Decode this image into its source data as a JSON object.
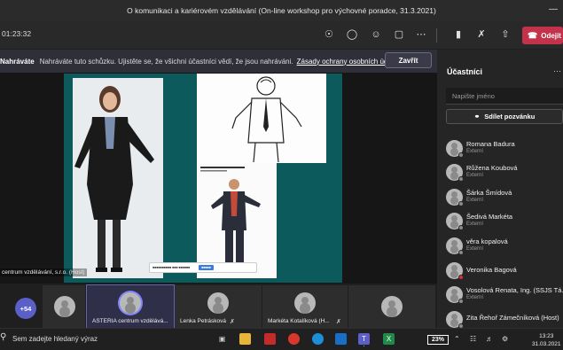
{
  "window": {
    "title": "O komunikaci a kariérovém vzdělávání (On-line workshop pro výchovné poradce, 31.3.2021)"
  },
  "toolbar": {
    "timer": "01:23:32",
    "leave_label": "Odejít"
  },
  "banner": {
    "title": "Nahráváte",
    "message": "Nahráváte tuto schůzku. Ujistěte se, že všichni účastníci vědí, že jsou nahráváni.",
    "link": "Zásady ochrany osobních údajů",
    "dismiss_label": "Zavřít"
  },
  "stage": {
    "host_label": "centrum vzdělávání, s.r.o. (Host)"
  },
  "strip": {
    "more_count": "+54",
    "tiles": [
      {
        "name": "ASTERIA centrum vzdělává..."
      },
      {
        "name": "Lenka Petrásková"
      },
      {
        "name": "Markéta Kotalíková (H..."
      }
    ]
  },
  "panel": {
    "title": "Účastníci",
    "search_placeholder": "Napište jméno",
    "invite_label": "Sdílet pozvánku",
    "participants": [
      {
        "name": "Romana Badura",
        "sub": "Externí"
      },
      {
        "name": "Růžena Koubová",
        "sub": "Externí"
      },
      {
        "name": "Šárka Šmídová",
        "sub": "Externí"
      },
      {
        "name": "Šedivá Markéta",
        "sub": "Externí"
      },
      {
        "name": "věra kopalová",
        "sub": "Externí"
      },
      {
        "name": "Veronika Bagová",
        "sub": ""
      },
      {
        "name": "Vosolová Renata, Ing. (SSJS Tá...",
        "sub": "Externí"
      },
      {
        "name": "Zita Řehoř Zámečníková (Host)",
        "sub": ""
      }
    ]
  },
  "taskbar": {
    "search_placeholder": "Sem zadejte hledaný výraz",
    "battery": "23%",
    "time": "13:23",
    "date": "31.03.2021"
  }
}
